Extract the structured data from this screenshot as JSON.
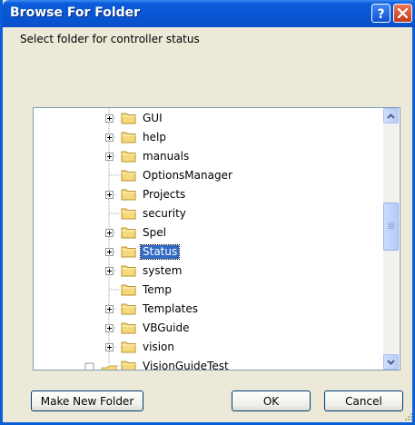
{
  "window": {
    "title": "Browse For Folder",
    "help_label": "?",
    "instruction": "Select folder for controller status"
  },
  "tree": {
    "selected": "Status",
    "items": [
      {
        "label": "GUI",
        "expandable": true
      },
      {
        "label": "help",
        "expandable": true
      },
      {
        "label": "manuals",
        "expandable": true
      },
      {
        "label": "OptionsManager",
        "expandable": false
      },
      {
        "label": "Projects",
        "expandable": true
      },
      {
        "label": "security",
        "expandable": false
      },
      {
        "label": "Spel",
        "expandable": true
      },
      {
        "label": "Status",
        "expandable": true
      },
      {
        "label": "system",
        "expandable": true
      },
      {
        "label": "Temp",
        "expandable": false
      },
      {
        "label": "Templates",
        "expandable": true
      },
      {
        "label": "VBGuide",
        "expandable": true
      },
      {
        "label": "vision",
        "expandable": true
      },
      {
        "label": "VisionGuideTest",
        "expandable": false
      }
    ]
  },
  "buttons": {
    "make_new_folder": "Make New Folder",
    "ok": "OK",
    "cancel": "Cancel"
  },
  "colors": {
    "titlebar": "#0a58d6",
    "selection": "#316ac5",
    "folder": "#f5d97a",
    "dialog_bg": "#ece9d8"
  },
  "icons": {
    "help": "help-icon",
    "close": "close-icon",
    "folder": "folder-icon",
    "expander": "plus-box-icon",
    "scroll_up": "scroll-up-arrow-icon",
    "scroll_down": "scroll-down-arrow-icon"
  }
}
